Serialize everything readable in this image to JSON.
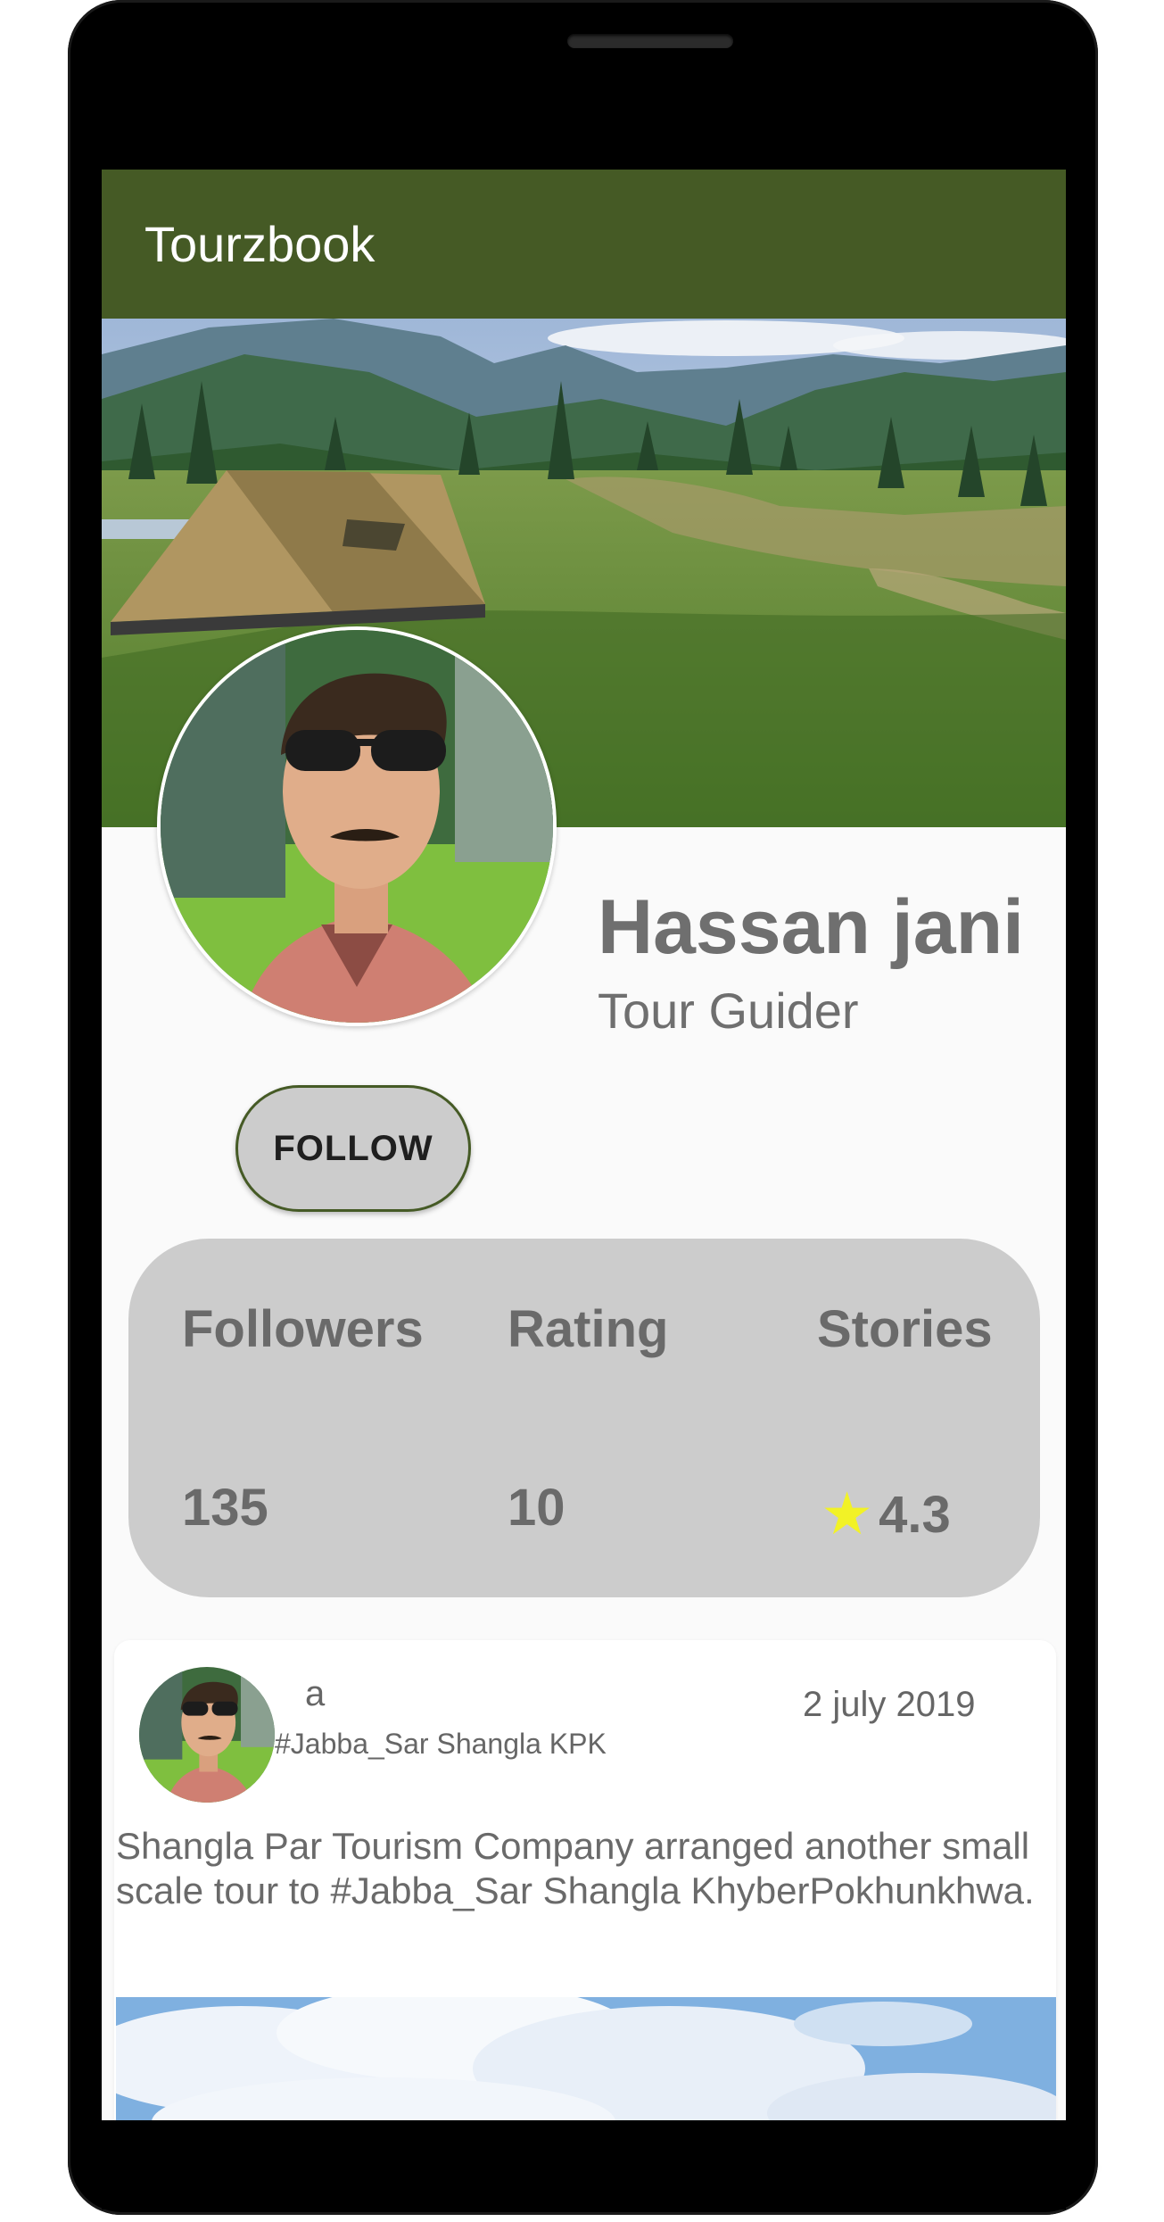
{
  "app": {
    "title": "Tourzbook"
  },
  "profile": {
    "name": "Hassan jani",
    "role": "Tour Guider",
    "follow_label": "FOLLOW"
  },
  "stats": {
    "labels": [
      "Followers",
      "Rating",
      "Stories"
    ],
    "followers_value": "135",
    "rating_value": "10",
    "stories_value": "4.3",
    "star_icon": "★"
  },
  "post": {
    "user": "a",
    "location": "#Jabba_Sar Shangla KPK",
    "date": "2 july 2019",
    "text": "Shangla Par Tourism Company arranged another small scale tour to #Jabba_Sar Shangla KhyberPokhunkhwa."
  },
  "colors": {
    "appbar": "#455a25",
    "stats_bg": "#cccccc",
    "star": "#f2f226"
  }
}
